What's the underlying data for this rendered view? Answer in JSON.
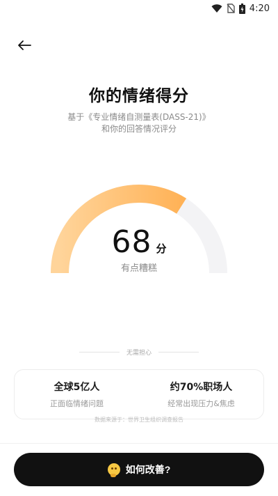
{
  "status_bar": {
    "time": "4:20"
  },
  "header": {
    "back_label": "返回"
  },
  "title": "你的情绪得分",
  "subtitle": {
    "line1": "基于《专业情绪自测量表(DASS-21)》",
    "line2": "和你的回答情况评分"
  },
  "score": {
    "value": "68",
    "unit": "分",
    "level": "有点糟糕",
    "fraction": 0.68
  },
  "divider_text": "无需担心",
  "stats": [
    {
      "title": "全球5亿人",
      "desc": "正面临情绪问题"
    },
    {
      "title": "约70%职场人",
      "desc": "经常出现压力&焦虑"
    }
  ],
  "source_note": "数据来源于：世界卫生组织调查报告",
  "cta": {
    "label": "如何改善?",
    "icon": "thinking-face-icon"
  },
  "colors": {
    "gauge_start": "#ffd49a",
    "gauge_end": "#ffb257",
    "gauge_track": "#f3f3f5",
    "button_bg": "#111111"
  }
}
